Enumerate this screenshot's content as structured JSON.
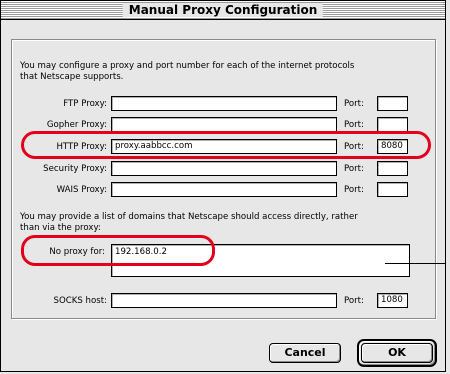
{
  "window": {
    "title": "Manual Proxy Configuration"
  },
  "intro": {
    "line1": "You may configure a proxy and port number for each of the internet protocols",
    "line2": "that Netscape supports."
  },
  "proxies": [
    {
      "label": "FTP Proxy:",
      "value": "",
      "port_label": "Port:",
      "port": ""
    },
    {
      "label": "Gopher Proxy:",
      "value": "",
      "port_label": "Port:",
      "port": ""
    },
    {
      "label": "HTTP Proxy:",
      "value": "proxy.aabbcc.com",
      "port_label": "Port:",
      "port": "8080"
    },
    {
      "label": "Security Proxy:",
      "value": "",
      "port_label": "Port:",
      "port": ""
    },
    {
      "label": "WAIS Proxy:",
      "value": "",
      "port_label": "Port:",
      "port": ""
    }
  ],
  "noproxy": {
    "line1": "You may provide a list of domains that Netscape should access directly, rather",
    "line2": "than via the proxy:",
    "label": "No proxy for:",
    "value": "192.168.0.2"
  },
  "socks": {
    "label": "SOCKS host:",
    "value": "",
    "port_label": "Port:",
    "port": "1080"
  },
  "buttons": {
    "cancel": "Cancel",
    "ok": "OK"
  },
  "colors": {
    "highlight": "#e2001a",
    "window_bg": "#e7e7e7"
  }
}
